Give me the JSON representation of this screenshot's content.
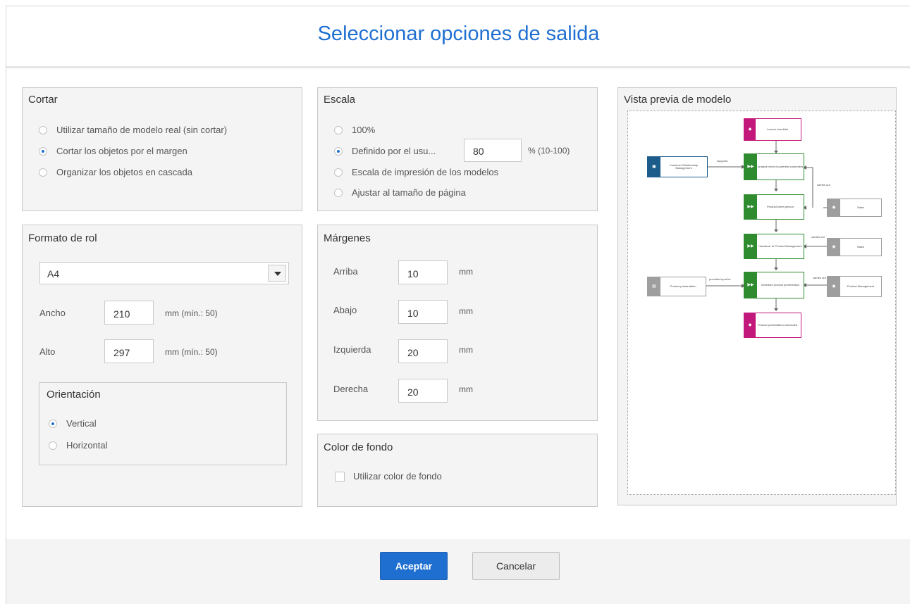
{
  "dialog": {
    "title": "Seleccionar opciones de salida"
  },
  "cortar": {
    "title": "Cortar",
    "options": [
      {
        "label": "Utilizar tamaño de modelo real (sin cortar)",
        "selected": false
      },
      {
        "label": "Cortar los objetos por el margen",
        "selected": true
      },
      {
        "label": "Organizar los objetos en cascada",
        "selected": false
      }
    ]
  },
  "formato": {
    "title": "Formato de rol",
    "paper_selected": "A4",
    "width_label": "Ancho",
    "width_value": "210",
    "width_unit": "mm (mín.: 50)",
    "height_label": "Alto",
    "height_value": "297",
    "height_unit": "mm (mín.: 50)",
    "orientation": {
      "title": "Orientación",
      "options": [
        {
          "label": "Vertical",
          "selected": true
        },
        {
          "label": "Horizontal",
          "selected": false
        }
      ]
    }
  },
  "escala": {
    "title": "Escala",
    "opt_100": "100%",
    "opt_user": "Definido por el usu...",
    "user_value": "80",
    "user_range": "% (10-100)",
    "opt_print": "Escala de impresión de los modelos",
    "opt_fit": "Ajustar al tamaño de página",
    "selected": "user"
  },
  "margenes": {
    "title": "Márgenes",
    "unit": "mm",
    "rows": [
      {
        "label": "Arriba",
        "value": "10"
      },
      {
        "label": "Abajo",
        "value": "10"
      },
      {
        "label": "Izquierda",
        "value": "20"
      },
      {
        "label": "Derecha",
        "value": "20"
      }
    ]
  },
  "color": {
    "title": "Color de fondo",
    "checkbox_label": "Utilizar color de fondo",
    "checked": false
  },
  "preview": {
    "title": "Vista previa de modelo",
    "nodes": {
      "launch": "Launch checklist",
      "crm": "Customer Relationship Management",
      "analyze": "Analyze need of potential customers",
      "product": "Product sheet person",
      "sales1": "Sales",
      "hand": "Handover to Product Management",
      "sales2": "Sales",
      "presentation": "Product presentation",
      "schedule": "Schedule product presentation",
      "pm": "Product Management",
      "scheduled": "Product presentation scheduled"
    },
    "edge_labels": {
      "supports": "supports",
      "carries_out1": "carries out",
      "carries_out2": "carries out",
      "provides_input": "provides input for",
      "carries_out3": "carries out"
    },
    "colors": {
      "event": "#c2187b",
      "function": "#2e8b2e",
      "crm": "#1c5c8a",
      "role": "#9e9e9e"
    }
  },
  "footer": {
    "ok_label": "Aceptar",
    "cancel_label": "Cancelar"
  }
}
